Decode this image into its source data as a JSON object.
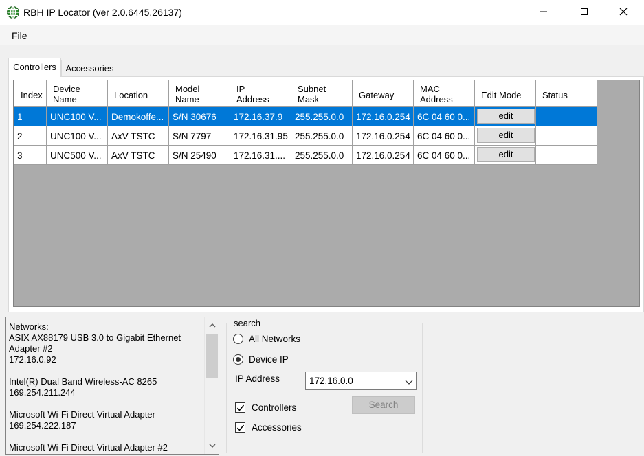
{
  "window": {
    "title": "RBH IP Locator (ver 2.0.6445.26137)"
  },
  "menu": {
    "file": "File"
  },
  "tabs": {
    "controllers": "Controllers",
    "accessories": "Accessories"
  },
  "grid": {
    "headers": {
      "index": "Index",
      "device_name": "Device\nName",
      "location": "Location",
      "model_name": "Model\nName",
      "ip_address": "IP\nAddress",
      "subnet_mask": "Subnet\nMask",
      "gateway": "Gateway",
      "mac_address": "MAC\nAddress",
      "edit_mode": "Edit Mode",
      "status": "Status"
    },
    "rows": [
      {
        "index": "1",
        "device_name": "UNC100 V...",
        "location": "Demokoffe...",
        "model_name": "S/N 30676",
        "ip_address": "172.16.37.9",
        "subnet_mask": "255.255.0.0",
        "gateway": "172.16.0.254",
        "mac_address": "6C 04 60 0...",
        "edit": "edit",
        "status": ""
      },
      {
        "index": "2",
        "device_name": "UNC100 V...",
        "location": "AxV TSTC",
        "model_name": "S/N 7797",
        "ip_address": "172.16.31.95",
        "subnet_mask": "255.255.0.0",
        "gateway": "172.16.0.254",
        "mac_address": "6C 04 60 0...",
        "edit": "edit",
        "status": ""
      },
      {
        "index": "3",
        "device_name": "UNC500 V...",
        "location": "AxV TSTC",
        "model_name": "S/N 25490",
        "ip_address": "172.16.31....",
        "subnet_mask": "255.255.0.0",
        "gateway": "172.16.0.254",
        "mac_address": "6C 04 60 0...",
        "edit": "edit",
        "status": ""
      }
    ],
    "selected_row": 1
  },
  "networks": {
    "text": "Networks:\nASIX AX88179 USB 3.0 to Gigabit Ethernet Adapter #2\n172.16.0.92\n\nIntel(R) Dual Band Wireless-AC 8265\n169.254.211.244\n\nMicrosoft Wi-Fi Direct Virtual Adapter\n169.254.222.187\n\nMicrosoft Wi-Fi Direct Virtual Adapter #2"
  },
  "search": {
    "legend": "search",
    "all_networks": "All Networks",
    "device_ip": "Device IP",
    "selected_mode": "device_ip",
    "ip_address_label": "IP Address",
    "ip_address_value": "172.16.0.0",
    "controllers_label": "Controllers",
    "controllers_checked": true,
    "accessories_label": "Accessories",
    "accessories_checked": true,
    "search_button": "Search",
    "search_button_enabled": false
  }
}
